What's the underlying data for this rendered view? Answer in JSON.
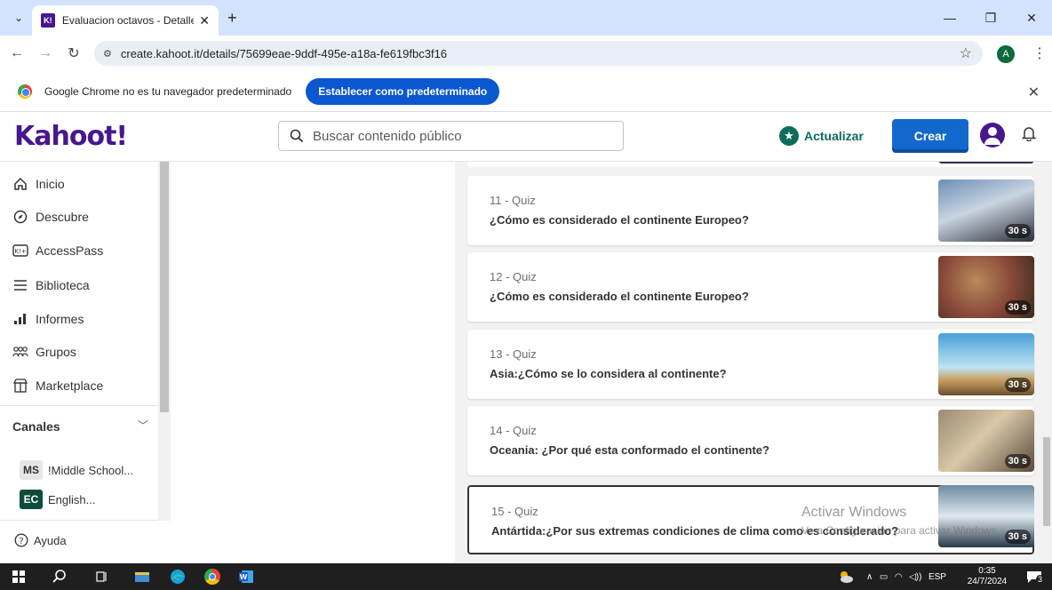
{
  "browser": {
    "tab_title": "Evaluacion octavos - Detalles - ",
    "tab_favicon_text": "K!",
    "url": "create.kahoot.it/details/75699eae-9ddf-495e-a18a-fe619fbc3f16",
    "profile_initial": "A"
  },
  "infobar": {
    "message": "Google Chrome no es tu navegador predeterminado",
    "button": "Establecer como predeterminado"
  },
  "header": {
    "logo": "Kahoot!",
    "search_placeholder": "Buscar contenido público",
    "upgrade": "Actualizar",
    "create": "Crear"
  },
  "sidebar": {
    "items": [
      {
        "label": "Inicio",
        "icon": "home-icon"
      },
      {
        "label": "Descubre",
        "icon": "compass-icon"
      },
      {
        "label": "AccessPass",
        "icon": "accesspass-icon"
      },
      {
        "label": "Biblioteca",
        "icon": "list-icon"
      },
      {
        "label": "Informes",
        "icon": "chart-icon"
      },
      {
        "label": "Grupos",
        "icon": "group-icon"
      },
      {
        "label": "Marketplace",
        "icon": "store-icon"
      }
    ],
    "channels_heading": "Canales",
    "channels": [
      {
        "badge": "MS",
        "label": "!Middle School...",
        "color": "#e6e6e6",
        "text_color": "#333333"
      },
      {
        "badge": "EC",
        "label": "English...",
        "color": "#0e4d3c",
        "text_color": "#ffffff"
      }
    ],
    "help": "Ayuda"
  },
  "questions": [
    {
      "type": "11 - Quiz",
      "text": "¿Cómo es considerado el continente Europeo?",
      "time": "30 s",
      "thumb_colors": [
        "#6d8fb8",
        "#2a2f3a",
        "#c9d4e0"
      ]
    },
    {
      "type": "12 - Quiz",
      "text": "¿Cómo es considerado el continente Europeo?",
      "time": "30 s",
      "thumb_colors": [
        "#5a3a2a",
        "#b88a5a",
        "#8a4a3a"
      ]
    },
    {
      "type": "13 - Quiz",
      "text": "Asia:¿Cómo se lo considera al continente?",
      "time": "30 s",
      "thumb_colors": [
        "#4aa0d8",
        "#bfe2f2",
        "#c9a060"
      ]
    },
    {
      "type": "14 - Quiz",
      "text": "Oceania: ¿Por qué esta conformado el continente?",
      "time": "30 s",
      "thumb_colors": [
        "#9a8a70",
        "#d8c8a8",
        "#5a4a3a"
      ]
    },
    {
      "type": "15 - Quiz",
      "text": "Antártida:¿Por sus extremas condiciones de clima como es considerado?",
      "time": "30 s",
      "thumb_colors": [
        "#6c8aa0",
        "#dfe8ee",
        "#2a3a4a"
      ]
    }
  ],
  "watermark": {
    "line1": "Activar Windows",
    "line2": "Ve a Configuración para activar Windows."
  },
  "taskbar": {
    "language": "ESP",
    "time": "0:35",
    "date": "24/7/2024",
    "notifications": "3"
  },
  "colors": {
    "kahoot_purple": "#46178f",
    "create_blue": "#1368ce",
    "chrome_blue": "#0b57d0",
    "upgrade_green": "#0e6c5b"
  }
}
